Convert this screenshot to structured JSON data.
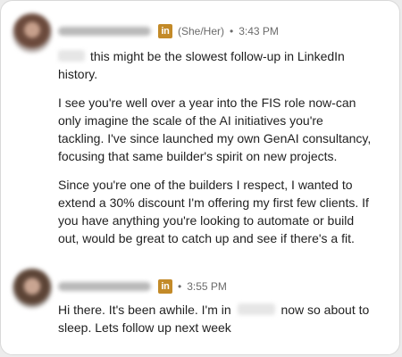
{
  "messages": [
    {
      "sender_blurred": true,
      "badge": "in",
      "pronouns": "(She/Her)",
      "separator": "•",
      "time": "3:43 PM",
      "paragraphs": [
        "this might be the slowest follow-up in LinkedIn history.",
        "I see you're well over a year into the FIS role now-can only imagine the scale of the AI initiatives you're tackling. I've since launched my own GenAI consultancy, focusing that same builder's spirit on new projects.",
        "Since you're one of the builders I respect, I wanted to extend a 30% discount I'm offering my first few clients. If you have anything you're looking to automate or build out, would be great to catch up and see if there's a fit."
      ]
    },
    {
      "sender_blurred": true,
      "badge": "in",
      "separator": "•",
      "time": "3:55 PM",
      "text_before_redaction": "Hi there. It's been awhile. I'm in",
      "text_after_redaction": "now so about to sleep. Lets follow up next week"
    }
  ],
  "colors": {
    "linkedin_badge": "#c38a28",
    "meta_text": "#6b6b6b",
    "body_text": "#1f1f1f"
  }
}
